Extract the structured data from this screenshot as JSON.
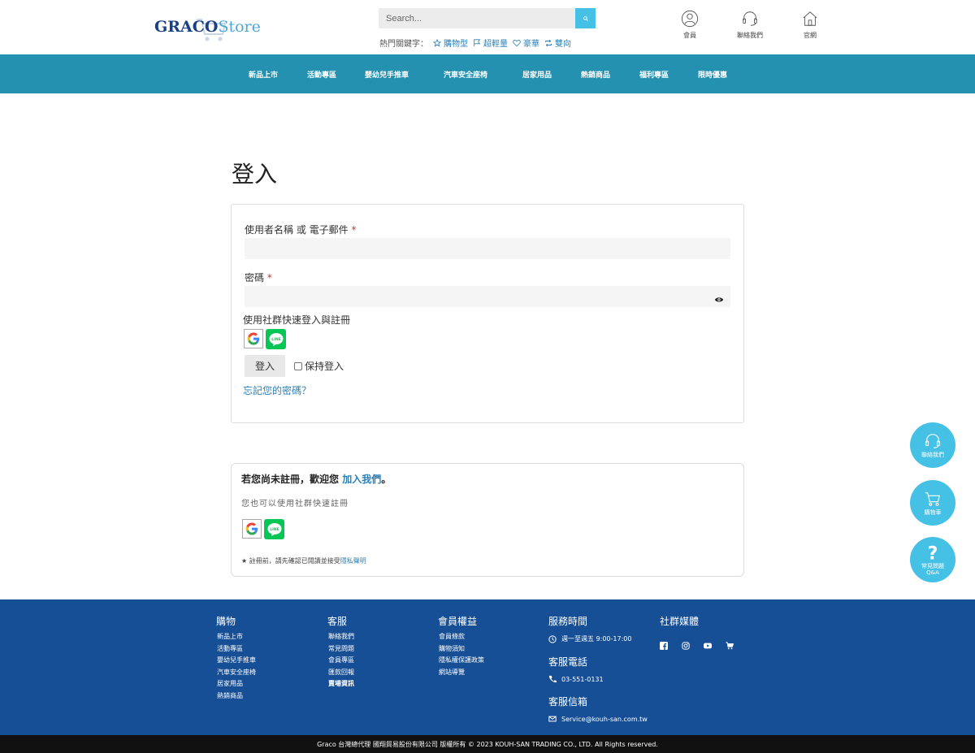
{
  "header": {
    "logo_main": "GRACO",
    "logo_store": "Store",
    "search_placeholder": "Search...",
    "hot_label": "熱門關鍵字：",
    "hot_keywords": [
      "購物型",
      "超輕量",
      "豪華",
      "雙向"
    ],
    "icons": [
      {
        "label": "會員",
        "icon": "user-icon"
      },
      {
        "label": "聯絡我們",
        "icon": "headset-icon"
      },
      {
        "label": "官網",
        "icon": "home-icon"
      }
    ]
  },
  "nav": {
    "items": [
      "新品上市",
      "活動專區",
      "嬰幼兒手推車",
      "汽車安全座椅",
      "居家用品",
      "熱銷商品",
      "福利專區",
      "限時優惠"
    ]
  },
  "login": {
    "title": "登入",
    "username_label": "使用者名稱 或 電子郵件",
    "password_label": "密碼",
    "required_mark": "*",
    "social_label": "使用社群快速登入與註冊",
    "login_button": "登入",
    "remember_label": "保持登入",
    "forgot_link": "忘記您的密碼？"
  },
  "register": {
    "title_prefix": "若您尚未註冊，歡迎您",
    "title_link": "加入我們",
    "title_suffix": "。",
    "subtitle": "您也可以使用社群快速註冊",
    "note_prefix": "★ 註冊前，請先確認已閱讀並接受",
    "note_link": "隱私聲明"
  },
  "floating": {
    "contact": "聯絡我們",
    "cart": "購物車",
    "faq_line1": "常見問題",
    "faq_line2": "Q&A"
  },
  "footer": {
    "shop": {
      "title": "購物",
      "links": [
        "新品上市",
        "活動專區",
        "嬰幼兒手推車",
        "汽車安全座椅",
        "居家用品",
        "熱銷商品"
      ]
    },
    "service": {
      "title": "客服",
      "links": [
        "聯絡我們",
        "常見問題",
        "會員專區",
        "匯款回報",
        "賣場資訊"
      ]
    },
    "member": {
      "title": "會員權益",
      "links": [
        "會員條款",
        "購物須知",
        "隱私權保護政策",
        "網站導覽"
      ]
    },
    "hours_title": "服務時間",
    "hours": "週一至週五 9:00-17:00",
    "phone_title": "客服電話",
    "phone": "03-551-0131",
    "email_title": "客服信箱",
    "email": "Service@kouh-san.com.tw",
    "social_title": "社群媒體",
    "copyright": "Graco 台灣總代理 國翔貿易股份有限公司 版權所有 © 2023 KOUH-SAN TRADING CO., LTD. All Rights reserved."
  }
}
